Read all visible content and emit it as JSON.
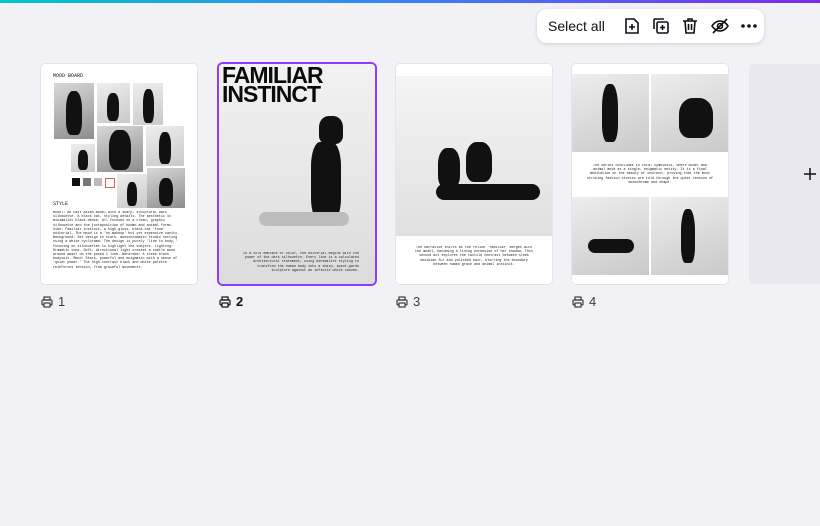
{
  "toolbar": {
    "select_all_label": "Select all",
    "icons": [
      "add-page-icon",
      "duplicate-icon",
      "trash-icon",
      "hide-icon",
      "more-icon"
    ]
  },
  "pages": [
    {
      "number": "1",
      "heading": "MOOD BOARD",
      "subheading": "STYLE",
      "body": "Model: An East Asian model with a sharp, sculptural dark silhouette. A black cat, styling details. The aesthetic is minimalist black-dense. All focused on a clean, graphic silhouette and the juxtaposition of human and animal forms. Vibe: Familiar instinct, a high-gloss, black-cat 'tone' editorial. The mood is a 'no-makeup' but yet expensive vanity. Background: Set design in stark, monochromatic studio setting using a white cyclorama. The design is purely 'line to body,' focusing on silhouettes to highlight the subject. Lighting: Dramatic tone. Soft, directional light creates a subtle mood around model on the posed 1 line. Wardrobe: A sleek black bodysuit. Mood: Stark, powerful and enigmatic with a sense of 'quiet power.' The high-contrast black and white palette reinforces tension, from graceful movements."
    },
    {
      "number": "2",
      "title": "FAMILIAR INSTINCT",
      "caption": "In a cold embrace of color, the editorial begins with the power of the dark silhouette. Every line is a calculated architectural statement, using minimalist styling to transform the human body into a sharp, avant-garde sculpture against an infinite white canvas."
    },
    {
      "number": "3",
      "caption": "The narrative shifts as the feline 'familiar' merges with the model, becoming a living extension of her shadow. This second act explores the tactile contrast between sleek obsidian fur and polished hair, blurring the boundary between human grace and animal instinct."
    },
    {
      "number": "4",
      "caption": "The series concludes in total symbiosis, where model and animal move as a single, enigmatic entity. It is a final meditation on the beauty of instinct, proving that the most striking fashion stories are told through the quiet tension of monochrome and shape."
    }
  ],
  "colors": {
    "accent": "#8b3dff",
    "background": "#f1f1f6"
  }
}
